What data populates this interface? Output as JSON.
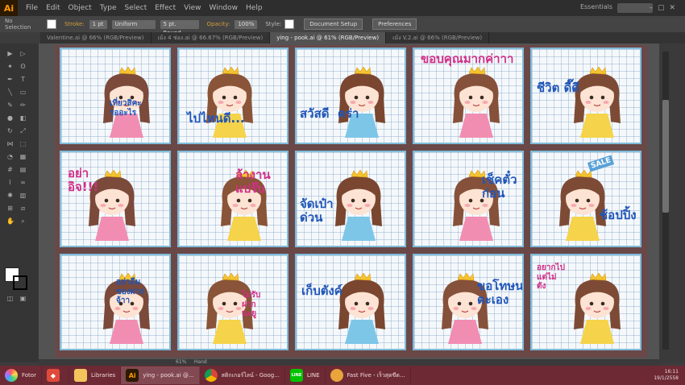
{
  "app": {
    "logo": "Ai"
  },
  "menu": [
    "File",
    "Edit",
    "Object",
    "Type",
    "Select",
    "Effect",
    "View",
    "Window",
    "Help"
  ],
  "workspace": "Essentials",
  "control_bar": {
    "selection": "No Selection",
    "stroke_label": "Stroke:",
    "stroke_value": "1 pt",
    "uniform": "Uniform",
    "brush": "5 pt. Round",
    "opacity_label": "Opacity:",
    "opacity_value": "100%",
    "style_label": "Style:",
    "document_setup": "Document Setup",
    "preferences": "Preferences"
  },
  "tabs": [
    {
      "label": "Valentine.ai @ 66% (RGB/Preview)",
      "active": false
    },
    {
      "label": "เม้ง 4 ช่อง.ai @ 66.67% (RGB/Preview)",
      "active": false
    },
    {
      "label": "ying - pook.ai @ 61% (RGB/Preview)",
      "active": true
    },
    {
      "label": "เม้ง V.2.ai @ 66% (RGB/Preview)",
      "active": false
    }
  ],
  "stickers": [
    {
      "text": "เที่ยวสิคะ\nรออะไร",
      "color": "blue"
    },
    {
      "text": "ไปไหนดี...",
      "color": "blue"
    },
    {
      "text": "สวัสดี  คร่า",
      "color": "blue"
    },
    {
      "text": "ขอบคุณมากค่าาา",
      "color": "pink"
    },
    {
      "text": "ชีวิต ดี๊ดี",
      "color": "blue"
    },
    {
      "text": "อย่า\nอิจ!!!",
      "color": "pink"
    },
    {
      "text": "ล้างาน\nแปร๊บ",
      "color": "pink"
    },
    {
      "text": "จัดเป๋า\nด่วน",
      "color": "blue"
    },
    {
      "text": "เช็คตั๋ว\nก่อน",
      "color": "blue"
    },
    {
      "text": "ช้อปปิ้ง",
      "color": "blue"
    },
    {
      "text": "อย่าลืม\nของฝาก\nจ้าา",
      "color": "blue"
    },
    {
      "text": "ไม่รับ\nฝาก\nนะยู",
      "color": "pink"
    },
    {
      "text": "เก็บตังค์",
      "color": "blue"
    },
    {
      "text": "ขอโทษนะ\nตะเอง",
      "color": "blue"
    },
    {
      "text": "อยากไป\nแต่ไม่\nตัง",
      "color": "pink"
    }
  ],
  "badge_sale": "SALE",
  "status": {
    "zoom": "61%",
    "tool": "Hand"
  },
  "taskbar": [
    {
      "label": "Fotor",
      "icon_color": "#3fa9f5"
    },
    {
      "label": "",
      "icon_color": "#e04a3a"
    },
    {
      "label": "Libraries",
      "icon_color": "#f4c55b"
    },
    {
      "label": "ying - pook.ai @...",
      "icon_color": "#2b1900",
      "active": true
    },
    {
      "label": "สติกเกอร์ไลน์ - Goog...",
      "icon_color": "#ffffff"
    },
    {
      "label": "LINE",
      "icon_color": "#00c300"
    },
    {
      "label": "Fast Five - เร็วสุดขีด...",
      "icon_color": "#e9a43b"
    }
  ],
  "clock": {
    "time": "16:11",
    "date": "19/1/2558"
  }
}
